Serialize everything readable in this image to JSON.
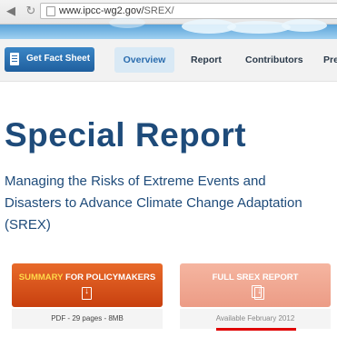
{
  "browser": {
    "url_host": "www.ipcc-wg2.gov/",
    "url_path": "SREX/",
    "icons": [
      "back-arrow-icon",
      "reload-icon",
      "page-icon"
    ]
  },
  "nav": {
    "fact_sheet_label": "Get Fact Sheet",
    "tabs": [
      {
        "label": "Overview",
        "active": true
      },
      {
        "label": "Report",
        "active": false
      },
      {
        "label": "Contributors",
        "active": false
      },
      {
        "label": "Pre",
        "active": false
      }
    ]
  },
  "main": {
    "title": "Special Report",
    "subtitle": "Managing the Risks of Extreme Events and Disasters to Advance Climate Change Adaptation (SREX)"
  },
  "cards": [
    {
      "label_accent": "SUMMARY",
      "label_rest": " FOR POLICYMAKERS",
      "info": "PDF - 29 pages - 8MB",
      "icon": "pdf-download-icon"
    },
    {
      "label_accent": "",
      "label_rest": "FULL SREX REPORT",
      "info": "Available February 2012",
      "icon": "documents-download-icon"
    }
  ],
  "colors": {
    "title": "#1e4b7a",
    "fact_button": "#2a6cae",
    "summary_button": "#d9531e",
    "report_button": "#f0a890",
    "accent_yellow": "#ffd84a",
    "underline_red": "#e00000"
  }
}
